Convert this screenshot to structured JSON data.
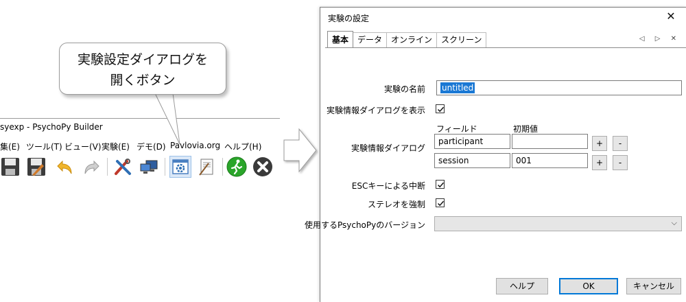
{
  "builder": {
    "title": "syexp - PsychoPy Builder",
    "menu": [
      "集(E)",
      "ツール(T)",
      "ビュー(V)",
      "実験(E)",
      "デモ(D)",
      "Pavlovia.org",
      "ヘルプ(H)"
    ],
    "toolbar_icons": [
      "save-icon",
      "save-as-icon",
      "undo-icon",
      "redo-icon",
      "preferences-icon",
      "monitor-center-icon",
      "experiment-settings-icon",
      "compile-script-icon",
      "run-icon",
      "stop-icon"
    ],
    "accent_colors": {
      "highlight": "#dbe8f7",
      "run_green": "#2aa52a",
      "stop_dark": "#3a3a3a"
    }
  },
  "callout": {
    "line1": "実験設定ダイアログを",
    "line2": "開くボタン"
  },
  "dialog": {
    "title": "実験の設定",
    "close": "✕",
    "tabs": [
      {
        "label": "基本",
        "active": true
      },
      {
        "label": "データ",
        "active": false
      },
      {
        "label": "オンライン",
        "active": false
      },
      {
        "label": "スクリーン",
        "active": false
      }
    ],
    "tab_scroll": "◁ ▷ ✕",
    "fields": {
      "experiment_name": {
        "label": "実験の名前",
        "value": "untitled"
      },
      "show_info_dialog": {
        "label": "実験情報ダイアログを表示",
        "checked": true
      },
      "info_dialog": {
        "label": "実験情報ダイアログ",
        "col_field": "フィールド",
        "col_default": "初期値",
        "rows": [
          {
            "field": "participant",
            "default": ""
          },
          {
            "field": "session",
            "default": "001"
          }
        ],
        "add": "+",
        "remove": "-"
      },
      "esc_quit": {
        "label": "ESCキーによる中断",
        "checked": true
      },
      "force_stereo": {
        "label": "ステレオを強制",
        "checked": true
      },
      "psychopy_version": {
        "label": "使用するPsychoPyのバージョン",
        "value": ""
      }
    },
    "buttons": {
      "help": "ヘルプ",
      "ok": "OK",
      "cancel": "キャンセル"
    },
    "accent_colors": {
      "selection": "#1a78d4",
      "default_button": "#0078d7"
    }
  }
}
